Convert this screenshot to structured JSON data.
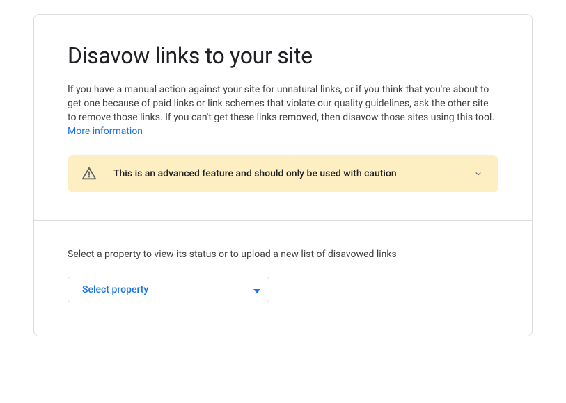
{
  "main": {
    "title": "Disavow links to your site",
    "description_part1": "If you have a manual action against your site for unnatural links, or if you think that you're about to get one because of paid links or link schemes that violate our quality guidelines, ask the other site to remove those links. If you can't get these links removed, then disavow those sites using this tool. ",
    "more_info_label": "More information",
    "warning_text": "This is an advanced feature and should only be used with caution",
    "instruction": "Select a property to view its status or to upload a new list of disavowed links",
    "dropdown_label": "Select property"
  }
}
